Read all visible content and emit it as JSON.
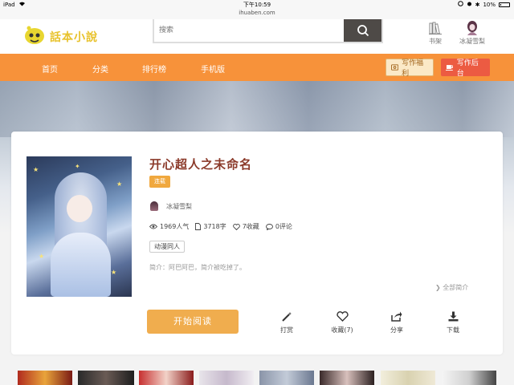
{
  "status_bar": {
    "device": "iPad",
    "time": "下午10:59",
    "battery": "10%"
  },
  "url": "ihuaben.com",
  "header": {
    "logo_text": "話本小說",
    "search_placeholder": "搜索",
    "bookshelf_label": "书架",
    "user_name": "冰凝雪梨"
  },
  "nav": {
    "items": [
      "首页",
      "分类",
      "排行榜",
      "手机版"
    ],
    "writing_benefits": "写作福利",
    "writing_backend": "写作后台",
    "colors": {
      "bar": "#f7923a",
      "backend_button": "#ec5b42"
    }
  },
  "book": {
    "title": "开心超人之未命名",
    "status_tag": "连载",
    "author": "冰凝雪梨",
    "popularity": "1969人气",
    "word_count": "3718字",
    "favorites": "7收藏",
    "comments": "0评论",
    "genre": "动漫同人",
    "intro": "简介：阿巴阿巴，简介被吃掉了。",
    "intro_more": "全部简介",
    "read_button": "开始阅读",
    "actions": {
      "reward": "打赏",
      "collect": "收藏(7)",
      "share": "分享",
      "download": "下载"
    }
  },
  "icons": [
    "wifi-icon",
    "search-icon",
    "bookshelf-icon",
    "user-avatar",
    "eye-icon",
    "document-icon",
    "heart-icon",
    "comment-icon",
    "magic-wand-icon",
    "share-icon",
    "download-icon"
  ]
}
